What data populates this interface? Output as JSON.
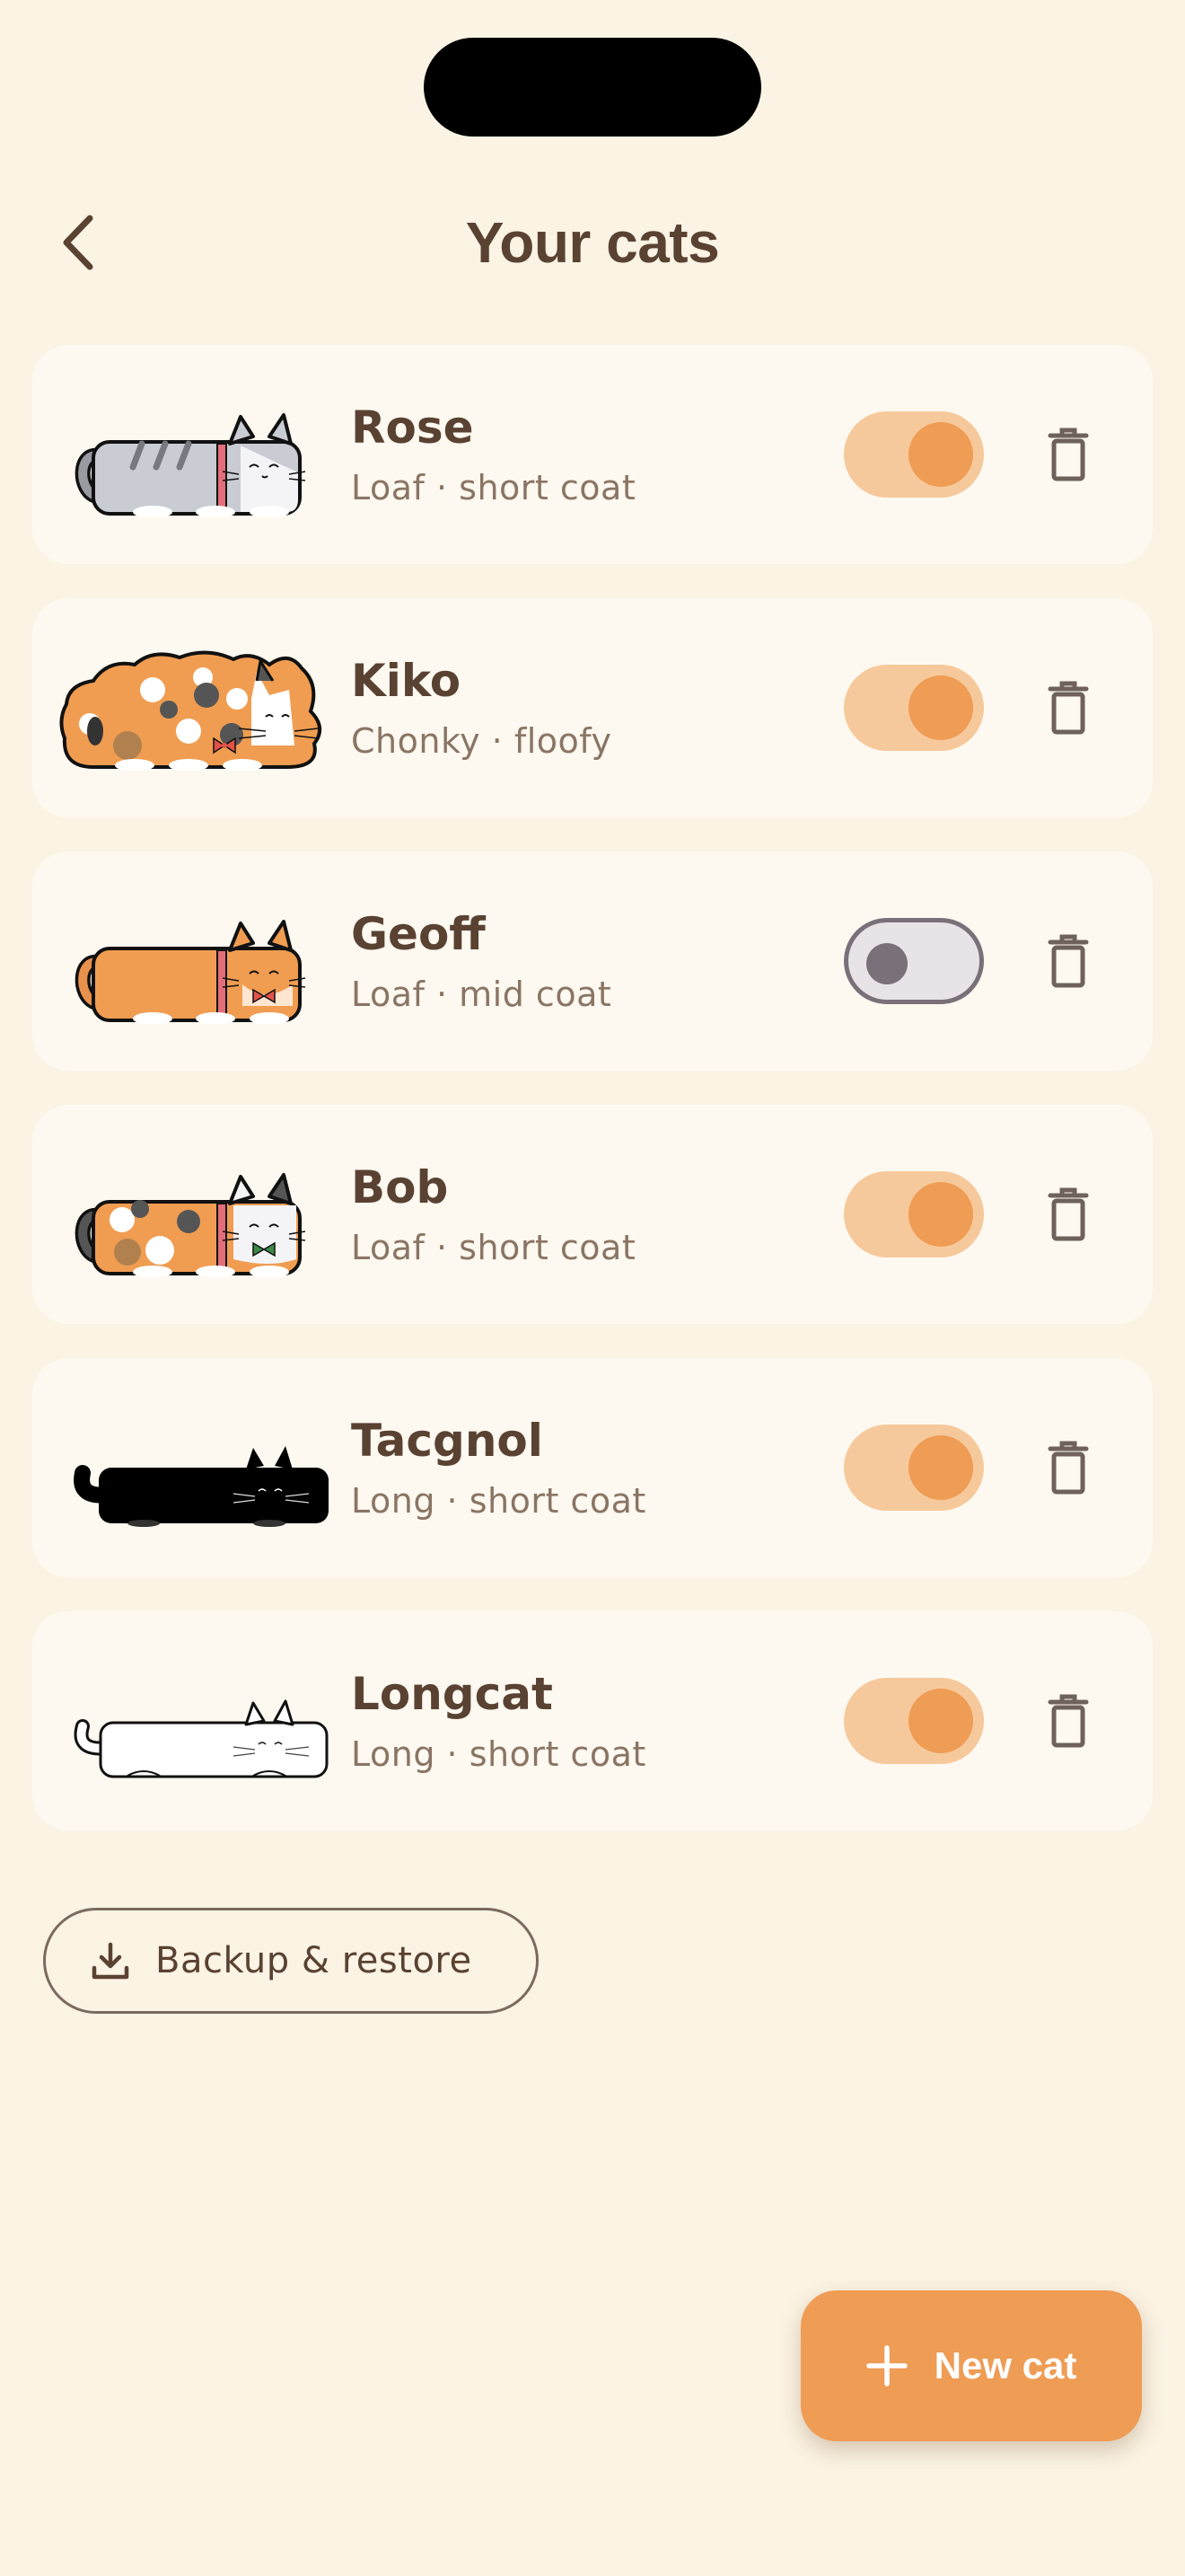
{
  "header": {
    "title": "Your cats",
    "back_icon": "chevron-left-icon"
  },
  "cats": [
    {
      "name": "Rose",
      "details": "Loaf · short coat",
      "enabled": true,
      "art": "grey-tabby-loaf"
    },
    {
      "name": "Kiko",
      "details": "Chonky · floofy",
      "enabled": true,
      "art": "calico-chonk-with-bowtie"
    },
    {
      "name": "Geoff",
      "details": "Loaf · mid coat",
      "enabled": false,
      "art": "orange-loaf-with-bowtie"
    },
    {
      "name": "Bob",
      "details": "Loaf · short coat",
      "enabled": true,
      "art": "calico-loaf-with-bowtie"
    },
    {
      "name": "Tacgnol",
      "details": "Long · short coat",
      "enabled": true,
      "art": "black-longcat"
    },
    {
      "name": "Longcat",
      "details": "Long · short coat",
      "enabled": true,
      "art": "white-longcat"
    }
  ],
  "actions": {
    "backup_label": "Backup & restore",
    "backup_icon": "download-icon",
    "new_cat_label": "New cat",
    "new_cat_icon": "plus-icon",
    "delete_icon": "trash-icon"
  },
  "colors": {
    "background": "#fbf3e4",
    "card": "#fef9f0",
    "accent": "#ef9c54",
    "accent_light": "#f6c99c",
    "text": "#5a4232",
    "muted": "#8a7565"
  }
}
